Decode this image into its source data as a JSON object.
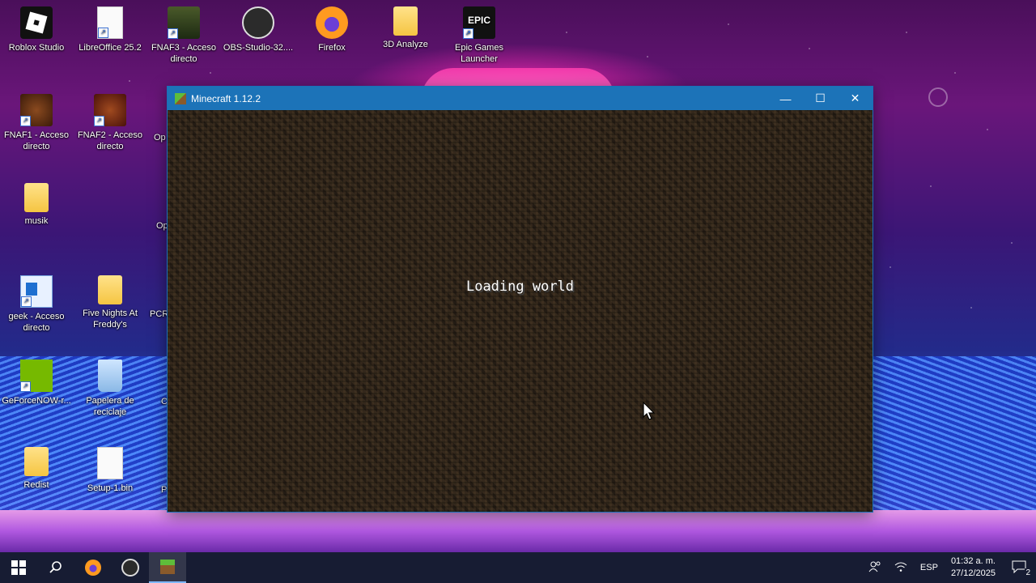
{
  "desktop": {
    "icons": [
      {
        "label": "Roblox Studio",
        "icon": "roblox-studio-icon"
      },
      {
        "label": "LibreOffice 25.2",
        "icon": "libreoffice-icon"
      },
      {
        "label": "FNAF3 - Acceso directo",
        "icon": "fnaf3-icon"
      },
      {
        "label": "OBS-Studio-32....",
        "icon": "obs-icon"
      },
      {
        "label": "Firefox",
        "icon": "firefox-icon"
      },
      {
        "label": "3D Analyze",
        "icon": "folder-icon"
      },
      {
        "label": "Epic Games Launcher",
        "icon": "epic-games-icon"
      },
      {
        "label": "FNAF1 - Acceso directo",
        "icon": "fnaf1-icon"
      },
      {
        "label": "FNAF2 - Acceso directo",
        "icon": "fnaf2-icon"
      },
      {
        "label": "musik",
        "icon": "folder-icon"
      },
      {
        "label": "geek - Acceso directo",
        "icon": "geek-icon"
      },
      {
        "label": "Five Nights At Freddy's",
        "icon": "folder-icon"
      },
      {
        "label": "GeForceNOW-r...",
        "icon": "geforce-now-icon"
      },
      {
        "label": "Papelera de reciclaje",
        "icon": "recycle-bin-icon"
      },
      {
        "label": "Redist",
        "icon": "folder-icon"
      },
      {
        "label": "Setup-1.bin",
        "icon": "file-icon"
      }
    ],
    "partial_labels": [
      "Op",
      "Op",
      "PCR",
      "C",
      "P"
    ]
  },
  "window": {
    "title": "Minecraft 1.12.2",
    "minimize": "—",
    "maximize": "☐",
    "close": "✕",
    "loading_text": "Loading world"
  },
  "taskbar": {
    "language": "ESP",
    "time": "01:32 a. m.",
    "date": "27/12/2025",
    "notifications_count": "2"
  }
}
